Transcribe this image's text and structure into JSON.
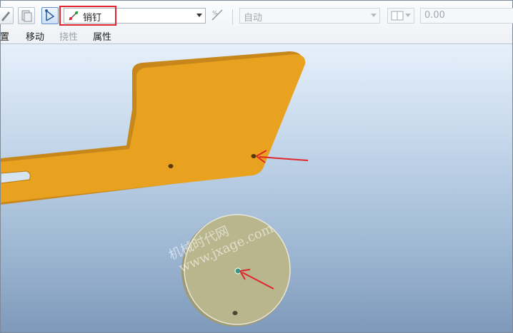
{
  "toolbar": {
    "labels": {
      "partial": "置",
      "move": "移动",
      "flip": "挠性",
      "properties": "属性"
    },
    "constraint_type": {
      "value": "销钉",
      "icon": "pin-constraint-icon"
    },
    "auto_combo": {
      "value": "自动"
    },
    "offset_field": {
      "value": "0.00"
    }
  },
  "watermark": {
    "line1": "机械时代网",
    "line2": "www.jxage.com"
  },
  "colors": {
    "part_orange": "#e9a21f",
    "disk_fill": "#b9b58c",
    "annotation_red": "#e0262c",
    "highlight_red": "#e0262c"
  }
}
